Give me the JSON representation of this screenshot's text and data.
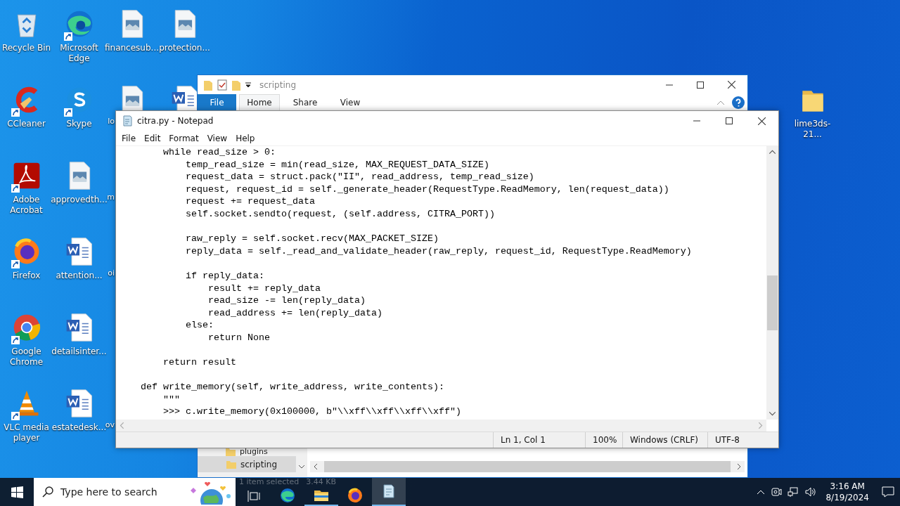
{
  "desktop": {
    "icons": [
      {
        "label": "Recycle Bin",
        "kind": "recycle",
        "shortcut": false
      },
      {
        "label": "CCleaner",
        "kind": "cleaner",
        "shortcut": true
      },
      {
        "label": "Adobe Acrobat",
        "kind": "pdf",
        "shortcut": true
      },
      {
        "label": "Firefox",
        "kind": "firefox",
        "shortcut": true
      },
      {
        "label": "Google Chrome",
        "kind": "chrome",
        "shortcut": true
      },
      {
        "label": "VLC media player",
        "kind": "cone",
        "shortcut": true
      },
      {
        "label": "Microsoft Edge",
        "kind": "edge",
        "shortcut": true
      },
      {
        "label": "Skype",
        "kind": "skype",
        "shortcut": true
      },
      {
        "label": "approvedth...",
        "kind": "image",
        "shortcut": false
      },
      {
        "label": "attention...",
        "kind": "word",
        "shortcut": false
      },
      {
        "label": "detailsinter...",
        "kind": "word",
        "shortcut": false
      },
      {
        "label": "estatedesk...",
        "kind": "word",
        "shortcut": false
      },
      {
        "label": "financesub...",
        "kind": "image",
        "shortcut": false
      },
      {
        "label": "lo",
        "kind": "image",
        "shortcut": false
      },
      {
        "label": "m"
      },
      {
        "label": "oi"
      },
      {
        "label": "ov"
      },
      {
        "label": "protection...",
        "kind": "image",
        "shortcut": false
      },
      {
        "kind": "word",
        "shortcut": false
      },
      {
        "label": "lime3ds-21...",
        "kind": "folder",
        "shortcut": false
      }
    ]
  },
  "explorer": {
    "title": "scripting",
    "tabs": [
      {
        "label": "File",
        "kind": "file",
        "selected": false
      },
      {
        "label": "Home",
        "kind": "tab",
        "selected": true
      },
      {
        "label": "Share",
        "kind": "tab",
        "selected": false
      },
      {
        "label": "View",
        "kind": "tab",
        "selected": false
      }
    ],
    "nav_items": [
      {
        "label": "plugins",
        "selected": false
      },
      {
        "label": "scripting",
        "selected": true
      }
    ],
    "status": [
      "1 item selected",
      "3.44 KB"
    ]
  },
  "notepad": {
    "title": "citra.py - Notepad",
    "menu": [
      "File",
      "Edit",
      "Format",
      "View",
      "Help"
    ],
    "content": "        while read_size > 0:\n            temp_read_size = min(read_size, MAX_REQUEST_DATA_SIZE)\n            request_data = struct.pack(\"II\", read_address, temp_read_size)\n            request, request_id = self._generate_header(RequestType.ReadMemory, len(request_data))\n            request += request_data\n            self.socket.sendto(request, (self.address, CITRA_PORT))\n\n            raw_reply = self.socket.recv(MAX_PACKET_SIZE)\n            reply_data = self._read_and_validate_header(raw_reply, request_id, RequestType.ReadMemory)\n\n            if reply_data:\n                result += reply_data\n                read_size -= len(reply_data)\n                read_address += len(reply_data)\n            else:\n                return None\n\n        return result\n\n    def write_memory(self, write_address, write_contents):\n        \"\"\"\n        >>> c.write_memory(0x100000, b\"\\\\xff\\\\xff\\\\xff\\\\xff\")",
    "status": [
      "Ln 1, Col 1",
      "100%",
      "Windows (CRLF)",
      "UTF-8"
    ]
  },
  "taskbar": {
    "search": {
      "placeholder": "Type here to search"
    },
    "apps": [
      {
        "kind": "edge",
        "running": false,
        "active": false
      },
      {
        "kind": "explorer",
        "running": true,
        "active": false
      },
      {
        "kind": "firefox",
        "running": false,
        "active": false
      },
      {
        "kind": "notepad",
        "running": true,
        "active": true
      }
    ],
    "clock": {
      "time": "3:16 AM",
      "date": "8/19/2024"
    }
  }
}
